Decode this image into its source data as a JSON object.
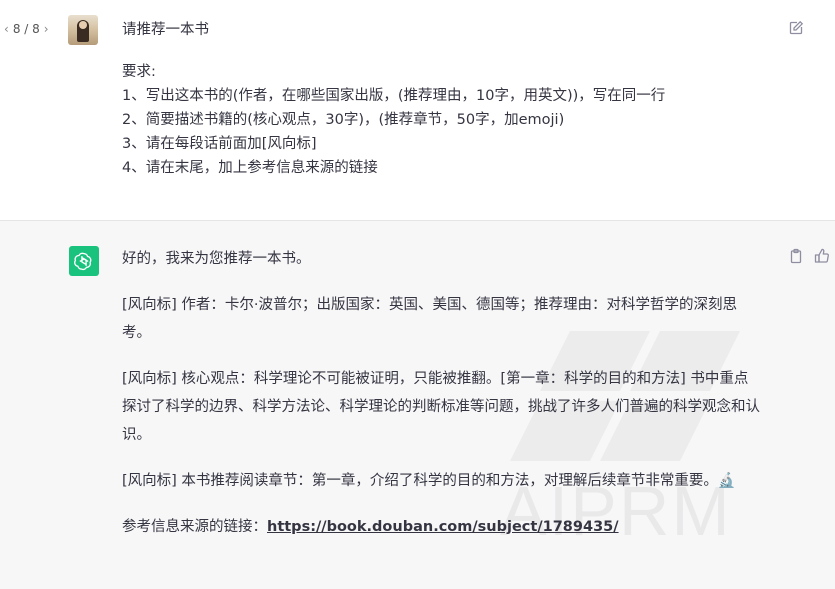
{
  "pager": {
    "prev_icon": "chevron-left-icon",
    "label": "8 / 8",
    "next_icon": "chevron-right-icon"
  },
  "user_message": {
    "title": "请推荐一本书",
    "requirements_heading": "要求:",
    "lines": [
      "1、写出这本书的(作者，在哪些国家出版，(推荐理由，10字，用英文))，写在同一行",
      "2、简要描述书籍的(核心观点，30字)，(推荐章节，50字，加emoji)",
      "3、请在每段话前面加[风向标]",
      "4、请在末尾，加上参考信息来源的链接"
    ]
  },
  "assistant_message": {
    "intro": "好的，我来为您推荐一本书。",
    "para1": "[风向标] 作者：卡尔·波普尔；出版国家：英国、美国、德国等；推荐理由：对科学哲学的深刻思考。",
    "para2": "[风向标] 核心观点：科学理论不可能被证明，只能被推翻。[第一章：科学的目的和方法] 书中重点探讨了科学的边界、科学方法论、科学理论的判断标准等问题，挑战了许多人们普遍的科学观念和认识。",
    "para3": "[风向标] 本书推荐阅读章节：第一章，介绍了科学的目的和方法，对理解后续章节非常重要。",
    "para3_emoji": "🔬",
    "source_label": "参考信息来源的链接：",
    "source_link": "https://book.douban.com/subject/1789435/"
  },
  "watermark": "AIPRM",
  "colors": {
    "gpt_green": "#19c37d",
    "assistant_bg": "#f7f7f8",
    "text": "#343541"
  }
}
